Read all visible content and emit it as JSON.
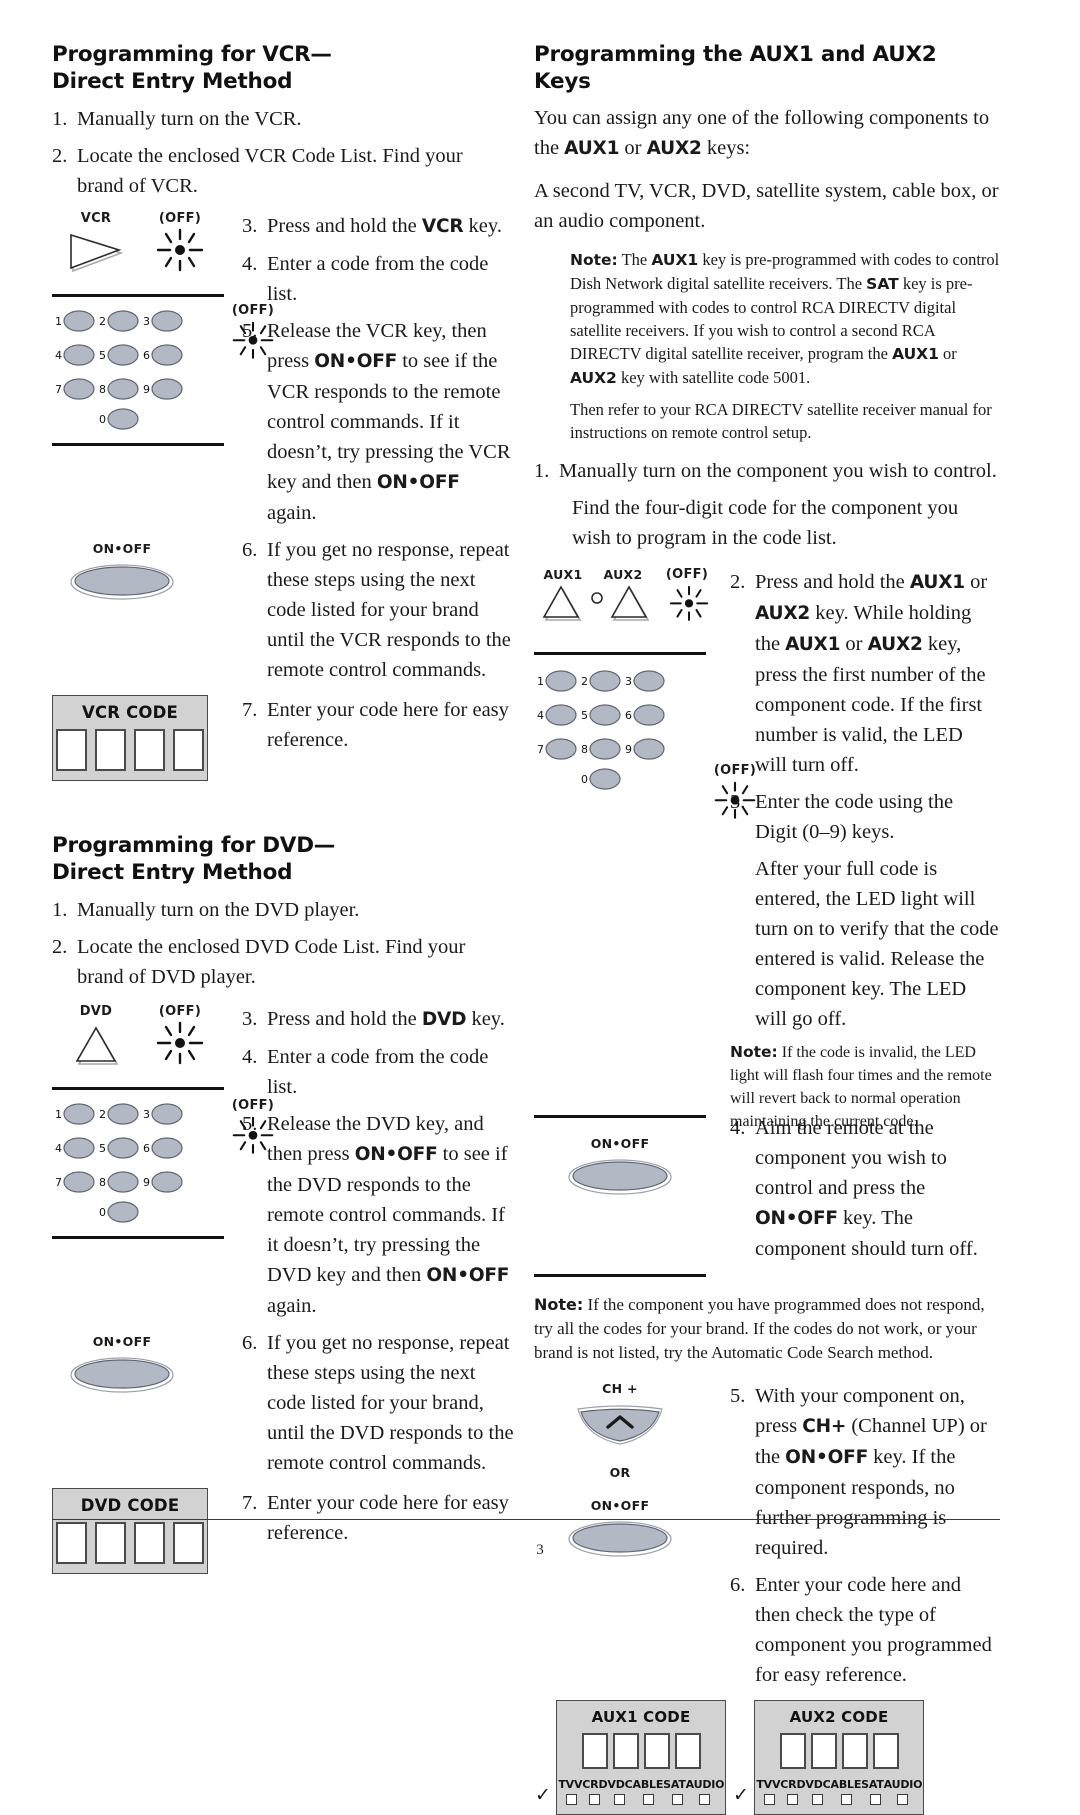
{
  "page": {
    "number": "3"
  },
  "left_column": {
    "vcr_section": {
      "heading_line1": "Programming for VCR—",
      "heading_line2": "Direct Entry Method",
      "steps": [
        {
          "num": "1.",
          "text": "Manually turn on the VCR."
        },
        {
          "num": "2.",
          "text": "Locate the enclosed VCR Code List. Find your brand of VCR."
        }
      ],
      "figure1": {
        "key_label": "VCR",
        "led_label": "(OFF)",
        "key_icon": "play-triangle-icon",
        "led_icon": "led-flash-icon"
      },
      "steps_group2": [
        {
          "num": "3.",
          "pre": "Press and hold the ",
          "bold": "VCR",
          "post": " key."
        },
        {
          "num": "4.",
          "pre": "Enter a code from the code list.",
          "bold": "",
          "post": ""
        }
      ],
      "step5": {
        "num": "5.",
        "p1": "Release the VCR key, then press ",
        "b1": "ON•OFF",
        "p2": " to see if the VCR responds to the remote control commands. If it doesn’t, try pressing the VCR key and then ",
        "b2": "ON•OFF",
        "p3": " again."
      },
      "figure2": {
        "led_label": "(OFF)",
        "digits": [
          "1",
          "2",
          "3",
          "4",
          "5",
          "6",
          "7",
          "8",
          "9",
          "0"
        ]
      },
      "step6": {
        "num": "6.",
        "text": "If you get no response, repeat these steps using the next code listed for your brand until the VCR responds to the remote control commands."
      },
      "figure3": {
        "key_label": "ON•OFF",
        "key_icon": "oval-power-key-icon"
      },
      "step7": {
        "num": "7.",
        "text": "Enter your code here for easy reference."
      },
      "code_box": {
        "title": "VCR CODE",
        "slots": [
          "",
          "",
          "",
          ""
        ]
      }
    },
    "dvd_section": {
      "heading_line1": "Programming for DVD—",
      "heading_line2": "Direct Entry Method",
      "steps": [
        {
          "num": "1.",
          "text": "Manually turn on the DVD player."
        },
        {
          "num": "2.",
          "text": "Locate the enclosed DVD Code List. Find your brand of DVD player."
        }
      ],
      "figure1": {
        "key_label": "DVD",
        "led_label": "(OFF)",
        "key_icon": "up-triangle-icon",
        "led_icon": "led-flash-icon"
      },
      "steps_group2": [
        {
          "num": "3.",
          "pre": "Press and hold the ",
          "bold": "DVD",
          "post": " key."
        },
        {
          "num": "4.",
          "pre": "Enter a code from the code list.",
          "bold": "",
          "post": ""
        }
      ],
      "step5": {
        "num": "5.",
        "p1": "Release the DVD key, and then press ",
        "b1": "ON•OFF",
        "p2": " to see if the DVD responds to the remote control commands. If it doesn’t, try pressing the DVD key and then ",
        "b2": "ON•OFF",
        "p3": " again."
      },
      "figure2": {
        "led_label": "(OFF)",
        "digits": [
          "1",
          "2",
          "3",
          "4",
          "5",
          "6",
          "7",
          "8",
          "9",
          "0"
        ]
      },
      "step6": {
        "num": "6.",
        "text": "If you get no response, repeat these steps using the next code listed for your brand, until the DVD responds to the remote control commands."
      },
      "figure3": {
        "key_label": "ON•OFF",
        "key_icon": "oval-power-key-icon"
      },
      "step7": {
        "num": "7.",
        "text": "Enter your code here for easy reference."
      },
      "code_box": {
        "title": "DVD CODE",
        "slots": [
          "",
          "",
          "",
          ""
        ]
      }
    }
  },
  "right_column": {
    "heading": "Programming the AUX1 and AUX2 Keys",
    "intro": {
      "p1a": "You can assign any one of the following components to the ",
      "b1": "AUX1",
      "p1b": " or ",
      "b2": "AUX2",
      "p1c": " keys:",
      "p2": "A second TV, VCR, DVD, satellite system, cable box, or an audio component."
    },
    "note1": {
      "label": "Note:",
      "t1": " The ",
      "b1": "AUX1",
      "t2": " key is pre-programmed with codes to control Dish Network digital satellite receivers. The ",
      "b2": "SAT",
      "t3": " key is pre-programmed with codes to control RCA DIRECTV digital satellite receivers. If you wish to control a second RCA DIRECTV digital satellite receiver, program the ",
      "b3": "AUX1",
      "t4": " or ",
      "b4": "AUX2",
      "t5": " key with satellite code 5001.",
      "p2": "Then refer to your RCA DIRECTV satellite receiver manual for instructions on remote control setup."
    },
    "step1": {
      "num": "1.",
      "text": "Manually turn on the component you wish to control.",
      "sub": "Find the four-digit code for the component you wish to program in the code list."
    },
    "figure_aux": {
      "label1": "AUX1",
      "label2": "AUX2",
      "led_label": "(OFF)",
      "icon1": "up-triangle-icon",
      "icon_dot": "small-circle-icon",
      "icon2": "up-triangle-icon",
      "led_icon": "led-flash-icon"
    },
    "step2": {
      "num": "2.",
      "p1": "Press and hold the ",
      "b1": "AUX1",
      "p2": " or ",
      "b2": "AUX2",
      "p3": " key. While holding the ",
      "b3": "AUX1",
      "p4": " or ",
      "b4": "AUX2",
      "p5": " key, press the first number of the component code. If the first number is valid, the LED will turn off."
    },
    "figure_keypad": {
      "led_label": "(OFF)",
      "digits": [
        "1",
        "2",
        "3",
        "4",
        "5",
        "6",
        "7",
        "8",
        "9",
        "0"
      ]
    },
    "step3": {
      "num": "3.",
      "text": "Enter the code using the Digit (0–9) keys.",
      "sub": "After your full code is entered, the LED light will turn on to verify that the code entered is valid. Release the component key. The LED will go off."
    },
    "note2": {
      "label": "Note:",
      "text": " If the code is invalid, the LED light will flash four times and the remote will revert back to normal operation maintaining the current code."
    },
    "figure_onoff": {
      "key_label": "ON•OFF",
      "key_icon": "oval-power-key-icon"
    },
    "step4": {
      "num": "4.",
      "p1": "Aim the remote at the component you wish to control and press the ",
      "b1": "ON•OFF",
      "p2": " key. The component should turn off."
    },
    "note3": {
      "label": "Note:",
      "text": " If the component you have programmed does not respond, try all the codes for your brand. If the codes do not work, or your brand is not listed, try the Automatic Code Search method."
    },
    "figure_chplus": {
      "ch_label": "CH +",
      "or_label": "OR",
      "onoff_label": "ON•OFF",
      "ch_icon": "channel-up-key-icon",
      "onoff_icon": "oval-power-key-icon"
    },
    "step5": {
      "num": "5.",
      "p1": "With your component on, press ",
      "b1": "CH+",
      "p2": " (Channel UP) or the ",
      "b2": "ON•OFF",
      "p3": " key. If the component responds, no further programming is required."
    },
    "step6": {
      "num": "6.",
      "text": "Enter your code here and then check the type of component you programmed for easy reference."
    },
    "aux1_box": {
      "title": "AUX1 CODE",
      "slots": [
        "",
        "",
        "",
        ""
      ],
      "component_labels": [
        "TV",
        "VCR",
        "DVD",
        "CABLE",
        "SAT",
        "AUDIO"
      ],
      "checkmark": "✓"
    },
    "aux2_box": {
      "title": "AUX2 CODE",
      "slots": [
        "",
        "",
        "",
        ""
      ],
      "component_labels": [
        "TV",
        "VCR",
        "DVD",
        "CABLE",
        "SAT",
        "AUDIO"
      ],
      "checkmark": "✓"
    }
  },
  "colors": {
    "key_fill": "#b3b9c4",
    "panel_fill": "#d2d2d2",
    "ink": "#1a1a1a"
  }
}
